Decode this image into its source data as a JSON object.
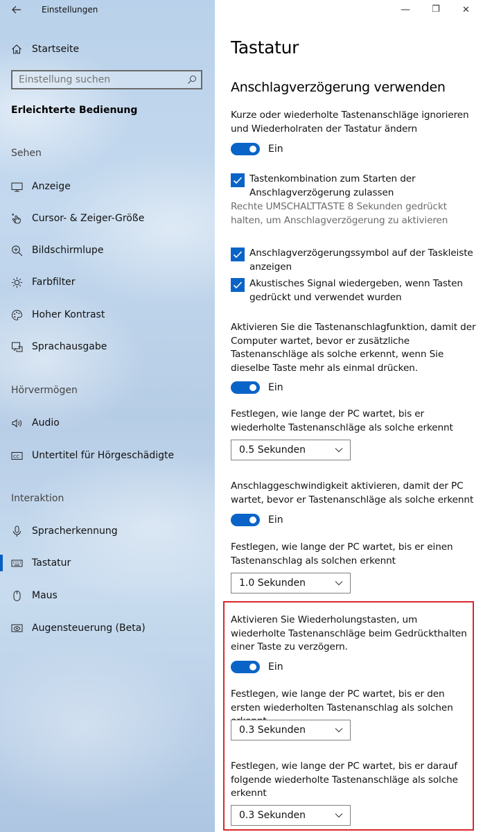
{
  "window": {
    "title": "Einstellungen",
    "minimize_label": "—",
    "maximize_label": "❐",
    "close_label": "✕"
  },
  "sidebar": {
    "home_label": "Startseite",
    "search_placeholder": "Einstellung suchen",
    "section_title": "Erleichterte Bedienung",
    "groups": {
      "sehen": "Sehen",
      "hoeren": "Hörvermögen",
      "interaktion": "Interaktion"
    },
    "items": [
      {
        "label": "Anzeige",
        "icon": "monitor-icon"
      },
      {
        "label": "Cursor- & Zeiger-Größe",
        "icon": "pointer-hand-icon"
      },
      {
        "label": "Bildschirmlupe",
        "icon": "magnifier-plus-icon"
      },
      {
        "label": "Farbfilter",
        "icon": "color-filter-sun-icon"
      },
      {
        "label": "Hoher Kontrast",
        "icon": "palette-icon"
      },
      {
        "label": "Sprachausgabe",
        "icon": "narrator-icon"
      },
      {
        "label": "Audio",
        "icon": "speaker-icon"
      },
      {
        "label": "Untertitel für Hörgeschädigte",
        "icon": "cc-icon"
      },
      {
        "label": "Spracherkennung",
        "icon": "microphone-icon"
      },
      {
        "label": "Tastatur",
        "icon": "keyboard-icon"
      },
      {
        "label": "Maus",
        "icon": "mouse-icon"
      },
      {
        "label": "Augensteuerung (Beta)",
        "icon": "eye-control-icon"
      }
    ],
    "active_item": "Tastatur"
  },
  "main": {
    "title": "Tastatur",
    "subtitle": "Anschlagverzögerung verwenden",
    "sticky_desc": "Kurze oder wiederholte Tastenanschläge ignorieren und Wiederholraten der Tastatur ändern",
    "toggle_on_label": "Ein",
    "check1_label": "Tastenkombination zum Starten der Anschlagverzögerung zulassen",
    "check1_hint": "Rechte UMSCHALTTASTE 8 Sekunden gedrückt halten, um Anschlagverzögerung zu aktivieren",
    "check2_label": "Anschlagverzögerungssymbol auf der Taskleiste anzeigen",
    "check3_label": "Akustisches Signal wiedergeben, wenn Tasten gedrückt und verwendet wurden",
    "bounce_desc": "Aktivieren Sie die Tastenanschlagfunktion, damit der Computer wartet, bevor er zusätzliche Tastenanschläge als solche erkennt, wenn Sie dieselbe Taste mehr als einmal drücken.",
    "bounce_wait_desc": "Festlegen, wie lange der PC wartet, bis er wiederholte Tastenanschläge als solche erkennt",
    "bounce_wait_value": "0.5 Sekunden",
    "slow_desc": "Anschlaggeschwindigkeit aktivieren, damit der PC wartet, bevor er Tastenanschläge als solche erkennt",
    "slow_wait_desc": "Festlegen, wie lange der PC wartet, bis er einen Tastenanschlag als solchen erkennt",
    "slow_wait_value": "1.0 Sekunden",
    "repeat_desc": "Aktivieren Sie Wiederholungstasten, um wiederholte Tastenanschläge beim Gedrückthalten einer Taste zu verzögern.",
    "repeat_first_desc": "Festlegen, wie lange der PC wartet, bis er den ersten wiederholten Tastenanschlag als solchen erkennt",
    "repeat_first_value": "0.3 Sekunden",
    "repeat_next_desc": "Festlegen, wie lange der PC wartet, bis er darauf folgende wiederholte Tastenanschläge als solche erkennt",
    "repeat_next_value": "0.3 Sekunden"
  },
  "colors": {
    "accent": "#0a64c8",
    "highlight_border": "#d9262c"
  }
}
